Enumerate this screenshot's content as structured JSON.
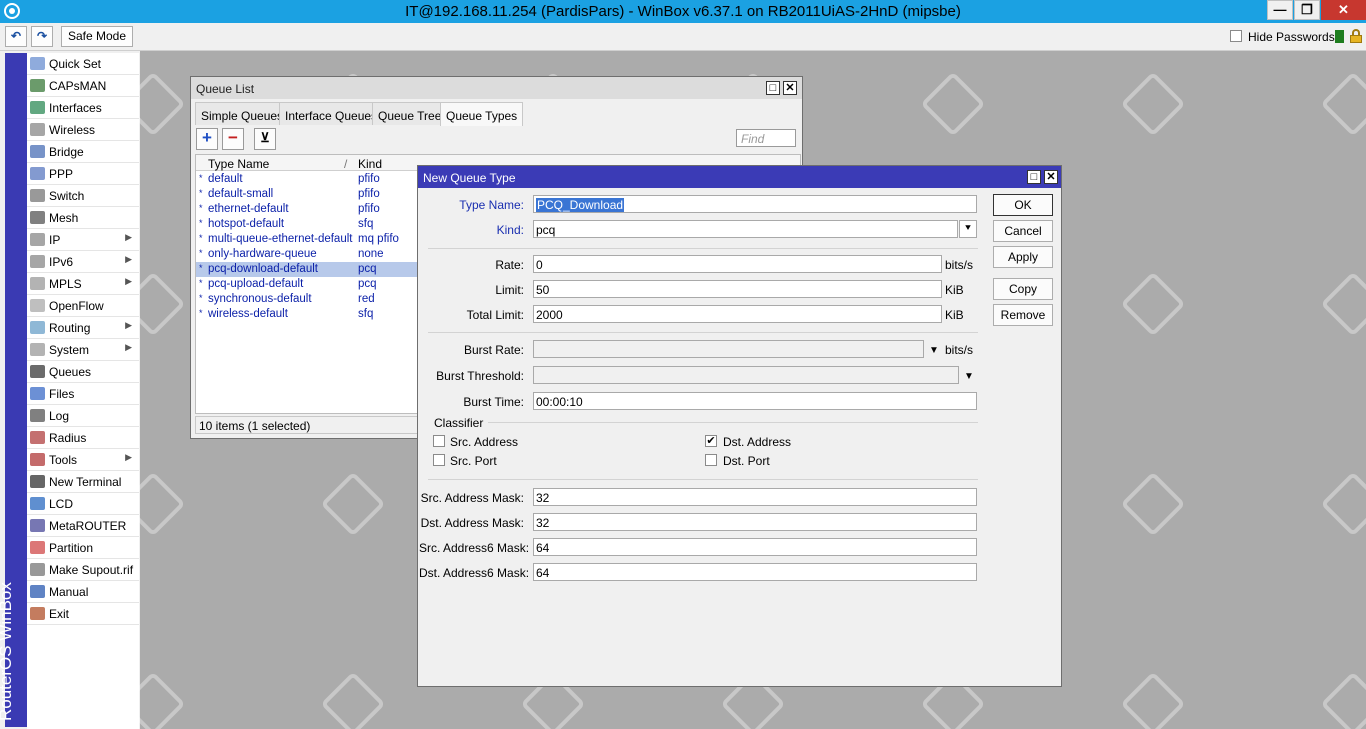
{
  "window": {
    "title": "IT@192.168.11.254 (PardisPars) - WinBox v6.37.1 on RB2011UiAS-2HnD (mipsbe)",
    "min_glyph": "—",
    "max_glyph": "❐",
    "close_glyph": "✕"
  },
  "toolbar": {
    "undo_glyph": "↶",
    "redo_glyph": "↷",
    "safe_mode_label": "Safe Mode",
    "hide_passwords_label": "Hide Passwords"
  },
  "side_strip": {
    "text": "RouterOS WinBox"
  },
  "menu": {
    "items": [
      {
        "label": "Quick Set",
        "icon": "quick-set-icon",
        "submenu": false
      },
      {
        "label": "CAPsMAN",
        "icon": "capsman-icon",
        "submenu": false
      },
      {
        "label": "Interfaces",
        "icon": "interfaces-icon",
        "submenu": false
      },
      {
        "label": "Wireless",
        "icon": "wireless-icon",
        "submenu": false
      },
      {
        "label": "Bridge",
        "icon": "bridge-icon",
        "submenu": false
      },
      {
        "label": "PPP",
        "icon": "ppp-icon",
        "submenu": false
      },
      {
        "label": "Switch",
        "icon": "switch-icon",
        "submenu": false
      },
      {
        "label": "Mesh",
        "icon": "mesh-icon",
        "submenu": false
      },
      {
        "label": "IP",
        "icon": "ip-icon",
        "submenu": true
      },
      {
        "label": "IPv6",
        "icon": "ipv6-icon",
        "submenu": true
      },
      {
        "label": "MPLS",
        "icon": "mpls-icon",
        "submenu": true
      },
      {
        "label": "OpenFlow",
        "icon": "openflow-icon",
        "submenu": false
      },
      {
        "label": "Routing",
        "icon": "routing-icon",
        "submenu": true
      },
      {
        "label": "System",
        "icon": "system-icon",
        "submenu": true
      },
      {
        "label": "Queues",
        "icon": "queues-icon",
        "submenu": false
      },
      {
        "label": "Files",
        "icon": "files-icon",
        "submenu": false
      },
      {
        "label": "Log",
        "icon": "log-icon",
        "submenu": false
      },
      {
        "label": "Radius",
        "icon": "radius-icon",
        "submenu": false
      },
      {
        "label": "Tools",
        "icon": "tools-icon",
        "submenu": true
      },
      {
        "label": "New Terminal",
        "icon": "terminal-icon",
        "submenu": false
      },
      {
        "label": "LCD",
        "icon": "lcd-icon",
        "submenu": false
      },
      {
        "label": "MetaROUTER",
        "icon": "metarouter-icon",
        "submenu": false
      },
      {
        "label": "Partition",
        "icon": "partition-icon",
        "submenu": false
      },
      {
        "label": "Make Supout.rif",
        "icon": "supout-icon",
        "submenu": false
      },
      {
        "label": "Manual",
        "icon": "manual-icon",
        "submenu": false
      },
      {
        "label": "Exit",
        "icon": "exit-icon",
        "submenu": false
      }
    ]
  },
  "queue_list": {
    "title": "Queue List",
    "tabs": [
      "Simple Queues",
      "Interface Queues",
      "Queue Tree",
      "Queue Types"
    ],
    "active_tab": "Queue Types",
    "add_glyph": "+",
    "remove_glyph": "−",
    "filter_glyph": "⊻",
    "find_placeholder": "Find",
    "columns": [
      "Type Name",
      "Kind"
    ],
    "sort_glyph": "/",
    "star": "*",
    "rows": [
      {
        "name": "default",
        "kind": "pfifo",
        "selected": false
      },
      {
        "name": "default-small",
        "kind": "pfifo",
        "selected": false
      },
      {
        "name": "ethernet-default",
        "kind": "pfifo",
        "selected": false
      },
      {
        "name": "hotspot-default",
        "kind": "sfq",
        "selected": false
      },
      {
        "name": "multi-queue-ethernet-default",
        "kind": "mq pfifo",
        "selected": false
      },
      {
        "name": "only-hardware-queue",
        "kind": "none",
        "selected": false
      },
      {
        "name": "pcq-download-default",
        "kind": "pcq",
        "selected": true
      },
      {
        "name": "pcq-upload-default",
        "kind": "pcq",
        "selected": false
      },
      {
        "name": "synchronous-default",
        "kind": "red",
        "selected": false
      },
      {
        "name": "wireless-default",
        "kind": "sfq",
        "selected": false
      }
    ],
    "status": "10 items (1 selected)"
  },
  "new_queue_type": {
    "title": "New Queue Type",
    "type_name_label": "Type Name:",
    "type_name_value": "PCQ_Download",
    "kind_label": "Kind:",
    "kind_value": "pcq",
    "rate_label": "Rate:",
    "rate_value": "0",
    "rate_unit": "bits/s",
    "limit_label": "Limit:",
    "limit_value": "50",
    "limit_unit": "KiB",
    "total_limit_label": "Total Limit:",
    "total_limit_value": "2000",
    "total_limit_unit": "KiB",
    "burst_rate_label": "Burst Rate:",
    "burst_rate_value": "",
    "burst_rate_unit": "bits/s",
    "burst_threshold_label": "Burst Threshold:",
    "burst_threshold_value": "",
    "burst_time_label": "Burst Time:",
    "burst_time_value": "00:00:10",
    "classifier_label": "Classifier",
    "src_address_label": "Src. Address",
    "src_address_checked": false,
    "dst_address_label": "Dst. Address",
    "dst_address_checked": true,
    "src_port_label": "Src. Port",
    "src_port_checked": false,
    "dst_port_label": "Dst. Port",
    "dst_port_checked": false,
    "check_glyph": "✔",
    "src_mask_label": "Src. Address Mask:",
    "src_mask_value": "32",
    "dst_mask_label": "Dst. Address Mask:",
    "dst_mask_value": "32",
    "src6_mask_label": "Src. Address6 Mask:",
    "src6_mask_value": "64",
    "dst6_mask_label": "Dst. Address6 Mask:",
    "dst6_mask_value": "64",
    "buttons": {
      "ok": "OK",
      "cancel": "Cancel",
      "apply": "Apply",
      "copy": "Copy",
      "remove": "Remove"
    },
    "drop_glyph": "▼",
    "max_glyph": "□",
    "close_glyph": "✕"
  },
  "colors": {
    "titlebar": "#1ba1e2",
    "dialog_title": "#3b3bb6",
    "strip": "#3a3ab3",
    "selection": "#b7c9ea",
    "link_text": "#0a1fa8"
  }
}
